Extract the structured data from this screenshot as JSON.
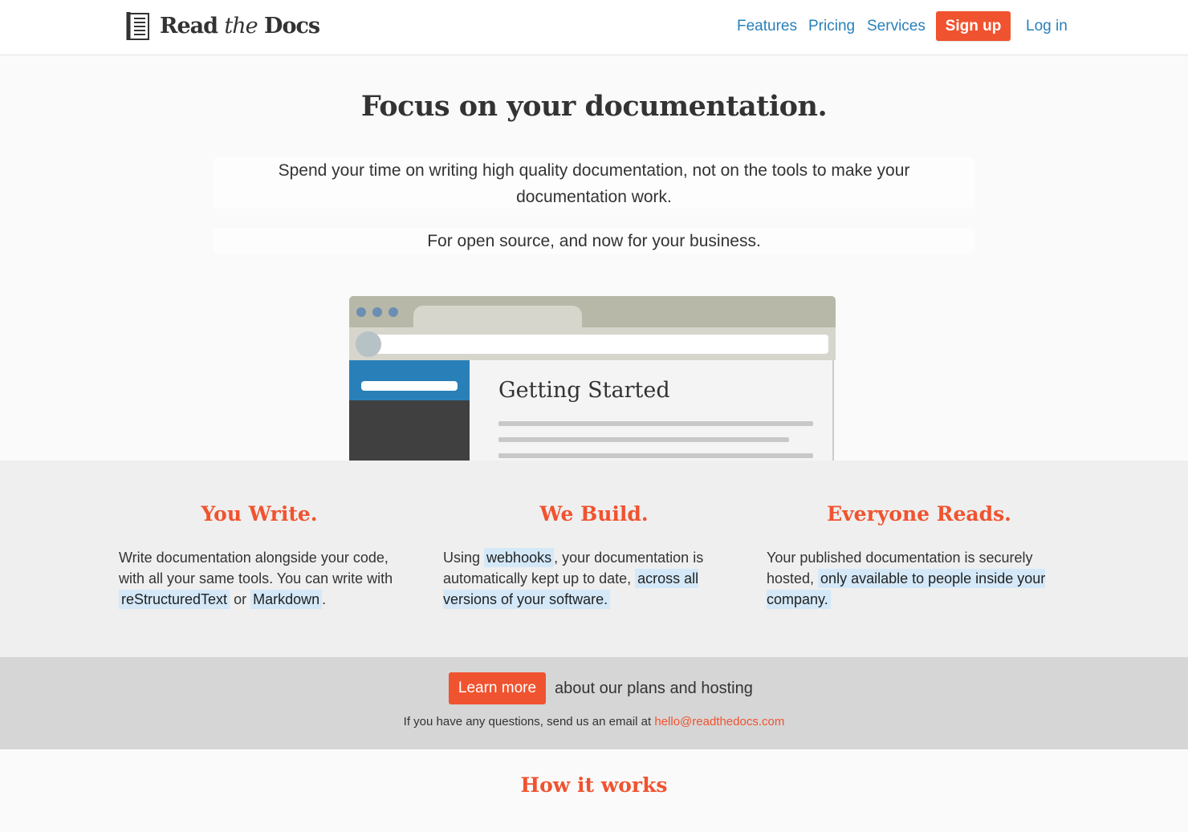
{
  "nav": {
    "logo": {
      "prefix": "Read",
      "the": "the",
      "suffix": "Docs"
    },
    "links": [
      "Features",
      "Pricing",
      "Services"
    ],
    "signup": "Sign up",
    "login": "Log in"
  },
  "hero": {
    "title": "Focus on your documentation.",
    "subtitle": "Spend your time on writing high quality documentation, not on the tools to make your documentation work.",
    "tagline": "For open source, and now for your business."
  },
  "mock": {
    "heading": "Getting Started"
  },
  "features": [
    {
      "title": "You Write.",
      "t1": "Write documentation alongside your code, with all your same tools. You can write with ",
      "h1": "reStructuredText",
      "t2": " or ",
      "h2": "Markdown",
      "t3": "."
    },
    {
      "title": "We Build.",
      "t1": "Using ",
      "h1": "webhooks",
      "t2": ", your documentation is automatically kept up to date, ",
      "h2": "across all versions of your software.",
      "t3": ""
    },
    {
      "title": "Everyone Reads.",
      "t1": "Your published documentation is securely hosted, ",
      "h1": "only available to people inside your company.",
      "t2": "",
      "h2": "",
      "t3": ""
    }
  ],
  "cta": {
    "button": "Learn more",
    "text": "about our plans and hosting",
    "mail_text": "If you have any questions, send us an email at ",
    "mail": "hello@readthedocs.com"
  },
  "how": "How it works",
  "colors": {
    "accent": "#f0532f",
    "link": "#2980b9"
  }
}
